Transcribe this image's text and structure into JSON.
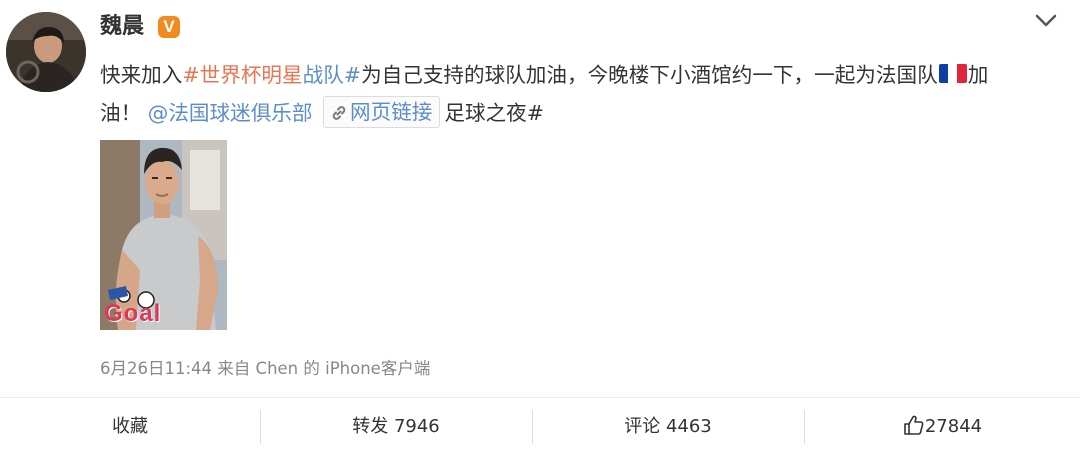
{
  "post": {
    "author": "魏晨",
    "verified_badge": "V",
    "text": {
      "p1": "快来加入",
      "tag1": "#世界杯明星",
      "tag1b": "战队#",
      "p2": "为自己支持的球队加油，今晚楼下小酒馆约一下，一起为法国队",
      "p3": "加",
      "p4": "油！",
      "mention": "@法国球迷俱乐部",
      "web_link": "网页链接",
      "p5": "足球之夜#"
    },
    "image_text": "Goal",
    "timestamp": "6月26日11:44",
    "source_prefix": "来自",
    "source": "Chen 的 iPhone客户端"
  },
  "actions": {
    "favorite": "收藏",
    "repost": "转发 7946",
    "comment": "评论 4463",
    "like": "27844"
  },
  "colors": {
    "topic": "#eb7350",
    "link": "#5b8dc9",
    "badge": "#f28b1f",
    "meta": "#888888"
  },
  "icons": [
    "chevron-down-icon",
    "link-icon",
    "thumbs-up-icon",
    "france-flag-icon"
  ]
}
